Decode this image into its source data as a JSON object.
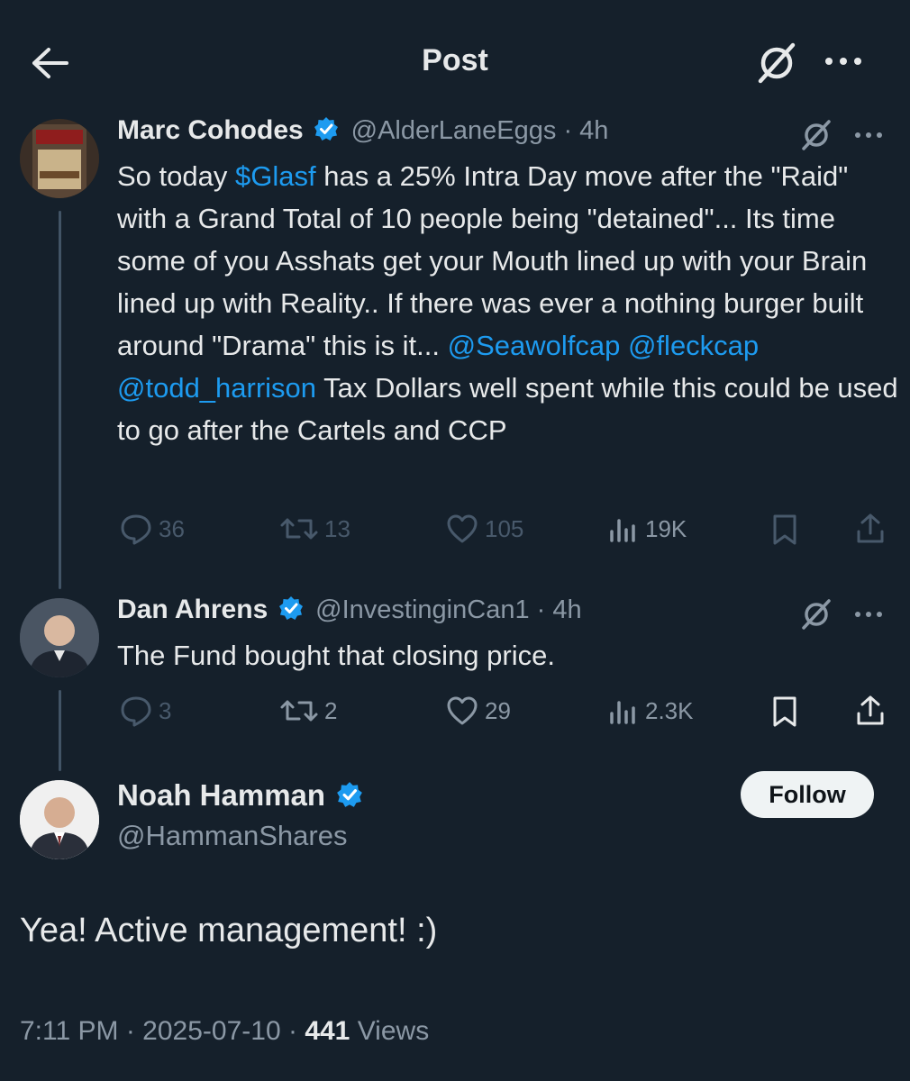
{
  "header": {
    "title": "Post"
  },
  "tweet1": {
    "name": "Marc Cohodes",
    "handle": "@AlderLaneEggs",
    "time": "4h",
    "avatar_label_top": "MARC COHO",
    "avatar_label_bottom": "BOURBON",
    "text": {
      "p1": "So today ",
      "cashtag": "$Glasf",
      "p2": " has a 25% Intra Day move after the \"Raid\" with a Grand Total of 10 people being \"detained\"... Its time some of you Asshats get your Mouth lined up with your Brain lined up with Reality.. If there was ever a nothing burger built around \"Drama\" this is it... ",
      "mention1": "@Seawolfcap",
      "sep": " ",
      "mention2": "@fleckcap",
      "mention3": "@todd_harrison",
      "p3": " Tax Dollars well spent while this could be used to go after the Cartels and CCP"
    },
    "stats": {
      "replies": "36",
      "reposts": "13",
      "likes": "105",
      "views": "19K"
    }
  },
  "tweet2": {
    "name": "Dan Ahrens",
    "handle": "@InvestinginCan1",
    "time": "4h",
    "text": "The Fund bought that closing price.",
    "stats": {
      "replies": "3",
      "reposts": "2",
      "likes": "29",
      "views": "2.3K"
    }
  },
  "main": {
    "name": "Noah Hamman",
    "handle": "@HammanShares",
    "follow_label": "Follow",
    "text": "Yea! Active management! :)",
    "time": "7:11 PM",
    "date": "2025-07-10",
    "views_count": "441",
    "views_label": "Views"
  },
  "icons": {
    "back": "arrow-left-icon",
    "grok": "grok-icon",
    "more": "more-dots-icon",
    "verified": "verified-badge-icon",
    "reply": "reply-icon",
    "repost": "repost-icon",
    "like": "heart-icon",
    "views": "bar-chart-icon",
    "bookmark": "bookmark-icon",
    "share": "share-icon"
  },
  "colors": {
    "background": "#15202b",
    "link": "#1d9bf0",
    "muted": "#8b98a5",
    "text": "#e7e9ea"
  }
}
